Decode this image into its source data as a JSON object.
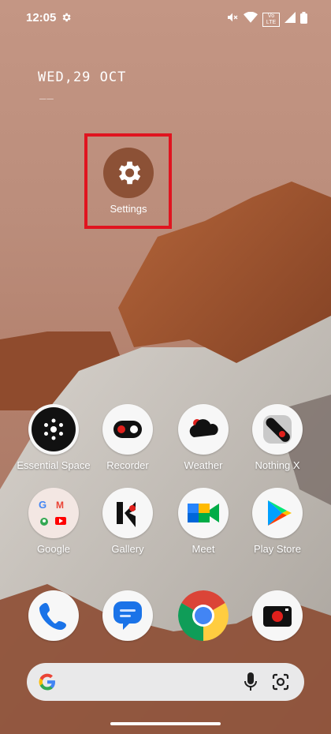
{
  "status_bar": {
    "time": "12:05",
    "network": "Vo LTE"
  },
  "date_widget": {
    "date": "WED,29 OCT",
    "sub": "__"
  },
  "home": {
    "settings_label": "Settings",
    "row1": [
      {
        "label": "Essential Space",
        "icon": "essential-space-icon"
      },
      {
        "label": "Recorder",
        "icon": "recorder-icon"
      },
      {
        "label": "Weather",
        "icon": "weather-icon"
      },
      {
        "label": "Nothing X",
        "icon": "nothing-x-icon"
      }
    ],
    "row2": [
      {
        "label": "Google",
        "icon": "google-folder-icon"
      },
      {
        "label": "Gallery",
        "icon": "gallery-icon"
      },
      {
        "label": "Meet",
        "icon": "meet-icon"
      },
      {
        "label": "Play Store",
        "icon": "play-store-icon"
      }
    ],
    "dock": [
      {
        "icon": "phone-icon"
      },
      {
        "icon": "messages-icon"
      },
      {
        "icon": "chrome-icon"
      },
      {
        "icon": "camera-icon"
      }
    ]
  },
  "colors": {
    "highlight": "#e0141f",
    "settings_bg": "#8c5136"
  }
}
